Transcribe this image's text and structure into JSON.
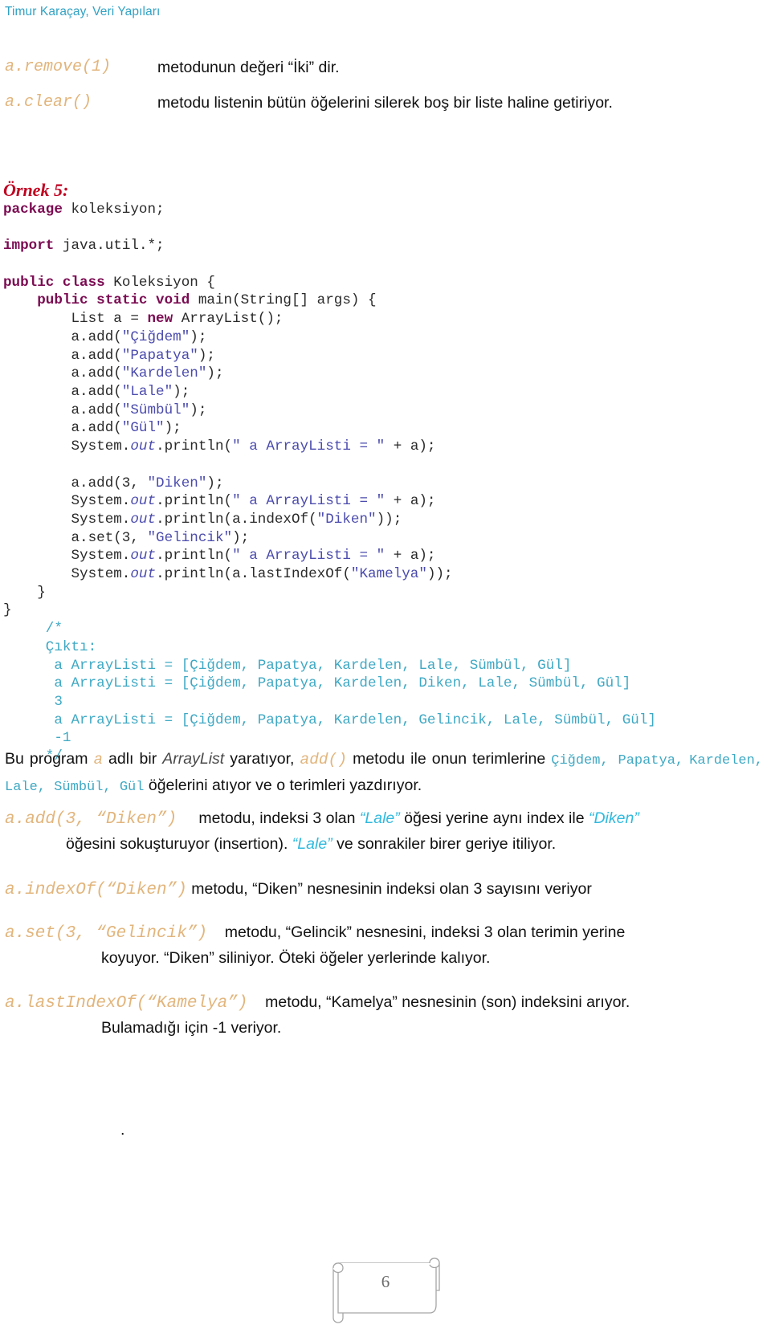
{
  "header": {
    "running_title": "Timur Karaçay, Veri Yapıları",
    "color": "#31A2C4"
  },
  "definitions": [
    {
      "signature": "a.remove(1)",
      "text": "metodunun değeri “İki” dir."
    },
    {
      "signature": "a.clear()",
      "text": "metodu listenin bütün öğelerini silerek boş bir liste haline getiriyor."
    }
  ],
  "example": {
    "label": "Örnek 5:",
    "label_color": "#C00020"
  },
  "code": {
    "language": "java",
    "keyword_color": "#7B0B52",
    "string_color": "#4B4BAE",
    "comment_color": "#3FA9C4",
    "lines": [
      "package koleksiyon;",
      "",
      "import java.util.*;",
      "",
      "public class Koleksiyon {",
      "    public static void main(String[] args) {",
      "        List a = new ArrayList();",
      "        a.add(\"Çiğdem\");",
      "        a.add(\"Papatya\");",
      "        a.add(\"Kardelen\");",
      "        a.add(\"Lale\");",
      "        a.add(\"Sümbül\");",
      "        a.add(\"Gül\");",
      "        System.out.println(\" a ArrayListi = \" + a);",
      "",
      "        a.add(3, \"Diken\");",
      "        System.out.println(\" a ArrayListi = \" + a);",
      "        System.out.println(a.indexOf(\"Diken\"));",
      "        a.set(3, \"Gelincik\");",
      "        System.out.println(\" a ArrayListi = \" + a);",
      "        System.out.println(a.lastIndexOf(\"Kamelya\"));",
      "    }",
      "}",
      "     /*",
      "     Çıktı:",
      "      a ArrayListi = [Çiğdem, Papatya, Kardelen, Lale, Sümbül, Gül]",
      "      a ArrayListi = [Çiğdem, Papatya, Kardelen, Diken, Lale, Sümbül, Gül]",
      "      3",
      "      a ArrayListi = [Çiğdem, Papatya, Kardelen, Gelincik, Lale, Sümbül, Gül]",
      "      -1",
      "     */"
    ],
    "output_comment": {
      "header": "Çıktı:",
      "lines": [
        "a ArrayListi = [Çiğdem, Papatya, Kardelen, Lale, Sümbül, Gül]",
        "a ArrayListi = [Çiğdem, Papatya, Kardelen, Diken, Lale, Sümbül, Gül]",
        "3",
        "a ArrayListi = [Çiğdem, Papatya, Kardelen, Gelincik, Lale, Sümbül, Gül]",
        "-1"
      ]
    }
  },
  "paragraphs": {
    "p1": {
      "t1": "Bu program ",
      "var_a": "a",
      "t2": " adlı bir ",
      "type_name": "ArrayList",
      "t3": " yaratıyor, ",
      "method": "add()",
      "t4": " metodu ile onun terimlerine ",
      "items1": "Çiğdem, Papatya,",
      "items2": "Kardelen, Lale, Sümbül, Gül",
      "t5": " öğelerini atıyor ve o terimleri yazdırıyor."
    },
    "p2": {
      "signature": "a.add(3, “Diken”)",
      "t1": "metodu, indeksi 3 olan ",
      "q1": "“Lale”",
      "t2": " öğesi yerine aynı index ile ",
      "q2": "“Diken”",
      "t3": "öğesini sokuşturuyor (insertion). ",
      "q3": "“Lale”",
      "t4": " ve sonrakiler birer geriye itiliyor."
    },
    "p3": {
      "signature": "a.indexOf(“Diken”)",
      "text": "metodu, “Diken” nesnesinin indeksi olan 3 sayısını veriyor"
    },
    "p4": {
      "signature": "a.set(3, “Gelincik”)",
      "t1": "metodu, “Gelincik” nesnesini, indeksi 3 olan terimin yerine",
      "t2": "koyuyor. “Diken” siliniyor. Öteki öğeler yerlerinde kalıyor."
    },
    "p5": {
      "signature": "a.lastIndexOf(“Kamelya”)",
      "t1": "metodu, “Kamelya” nesnesinin (son) indeksini arıyor.",
      "t2": "Bulamadığı için -1 veriyor."
    },
    "p6": {
      "text": "."
    }
  },
  "footer": {
    "page_number": "6"
  }
}
